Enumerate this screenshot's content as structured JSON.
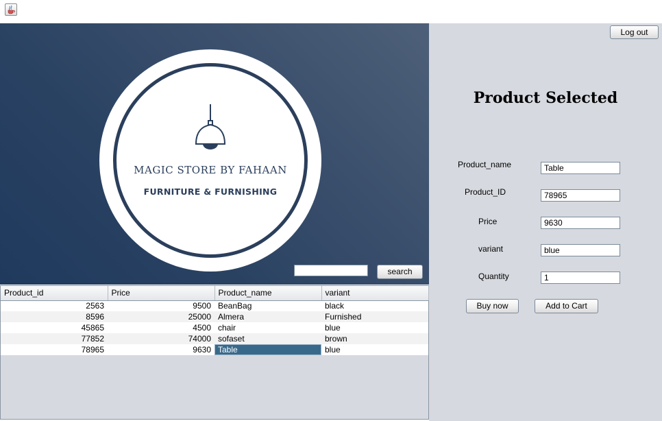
{
  "app": {
    "icon": "java-coffee-icon"
  },
  "brand": {
    "name": "MAGIC STORE BY FAHAAN",
    "tagline": "FURNITURE & FURNISHING",
    "colors": {
      "navy": "#2b3f5c",
      "banner_dark": "#1f3a5e",
      "banner_light": "#4e6079"
    }
  },
  "search": {
    "value": "",
    "button_label": "search"
  },
  "table": {
    "columns": [
      "Product_id",
      "Price",
      "Product_name",
      "variant"
    ],
    "rows": [
      {
        "id": "2563",
        "price": "9500",
        "name": "BeanBag",
        "variant": "black"
      },
      {
        "id": "8596",
        "price": "25000",
        "name": "Almera",
        "variant": "Furnished"
      },
      {
        "id": "45865",
        "price": "4500",
        "name": "chair",
        "variant": "blue"
      },
      {
        "id": "77852",
        "price": "74000",
        "name": "sofaset",
        "variant": "brown"
      },
      {
        "id": "78965",
        "price": "9630",
        "name": "Table",
        "variant": "blue"
      }
    ],
    "selected_row": 4,
    "selection_color": "#39698a"
  },
  "detail": {
    "logout_label": "Log out",
    "heading": "Product Selected",
    "fields": [
      {
        "label": "Product_name",
        "value": "Table"
      },
      {
        "label": "Product_ID",
        "value": "78965"
      },
      {
        "label": "Price",
        "value": "9630"
      },
      {
        "label": "variant",
        "value": "blue"
      },
      {
        "label": "Quantity",
        "value": "1"
      }
    ],
    "buy_label": "Buy now",
    "cart_label": "Add to Cart"
  }
}
